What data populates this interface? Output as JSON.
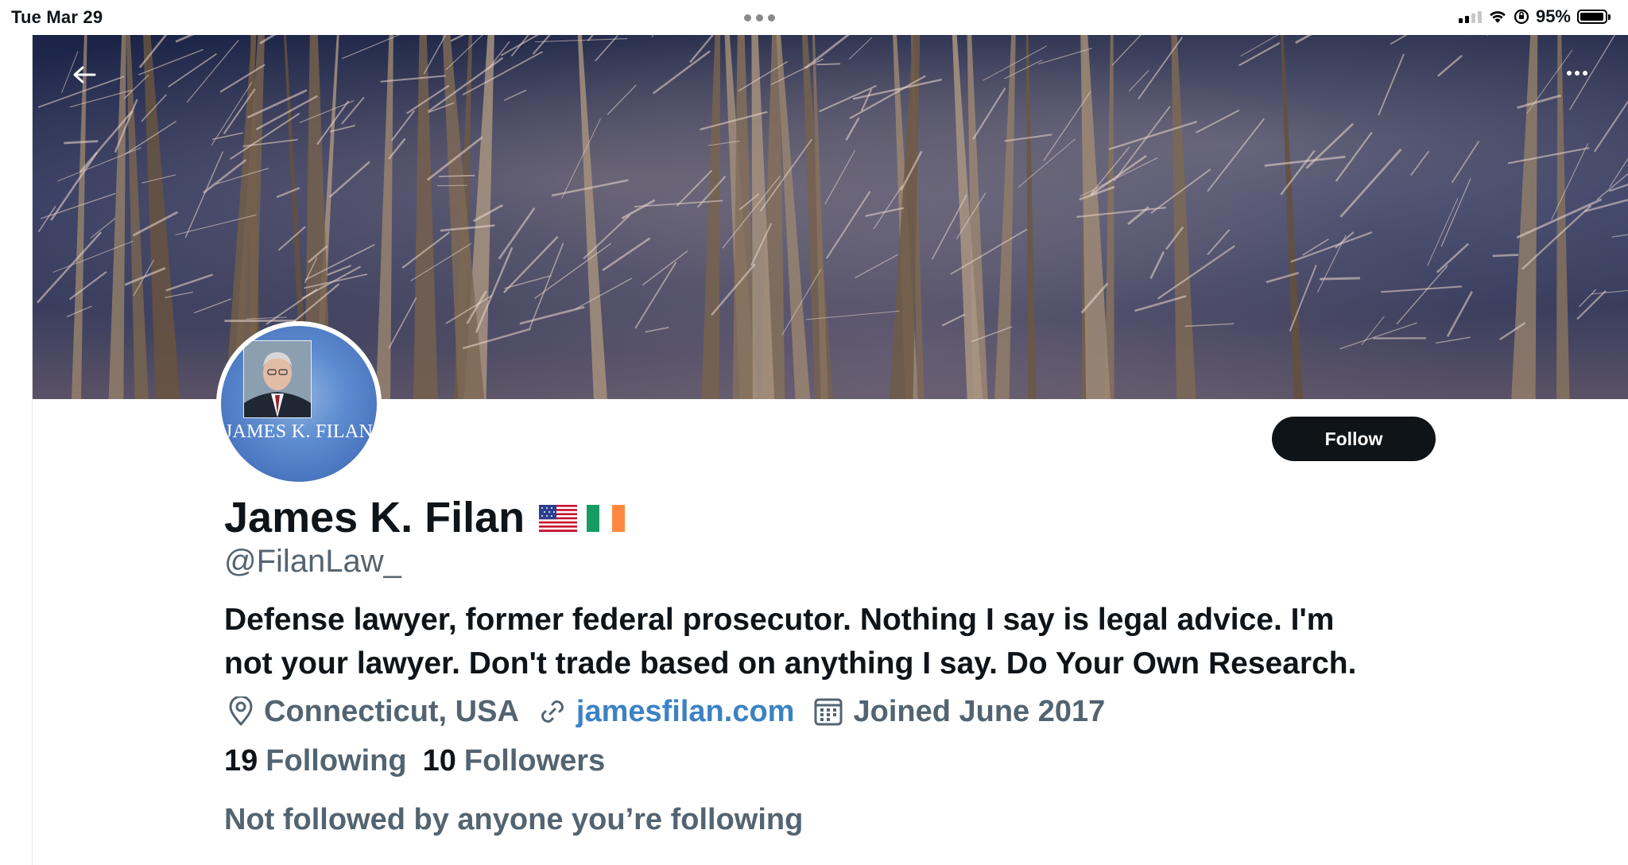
{
  "status_bar": {
    "time": "Tue Mar 29",
    "battery": "95%",
    "battery_level": 0.95
  },
  "header": {
    "back_icon": "arrow-left-icon",
    "more_icon": "more-horizontal-icon"
  },
  "profile": {
    "avatar_text": "JAMES K. FILAN",
    "display_name": "James K. Filan",
    "flags": [
      "us-flag-icon",
      "ireland-flag-icon"
    ],
    "handle": "@FilanLaw_",
    "bio_line1": "Defense lawyer, former federal prosecutor. Nothing I say is legal advice. I'm",
    "bio_line2": "not your lawyer. Don't trade based on anything I say. Do Your Own Research.",
    "location": "Connecticut, USA",
    "website": "jamesfilan.com",
    "joined": "Joined June 2017",
    "following_count": "19",
    "following_label": "Following",
    "followers_count": "10",
    "followers_label": "Followers",
    "not_followed_text": "Not followed by anyone you’re following",
    "follow_button": "Follow"
  },
  "colors": {
    "text": "#0f1419",
    "secondary": "#536471",
    "link": "#3b82c4",
    "button": "#0f1419"
  }
}
